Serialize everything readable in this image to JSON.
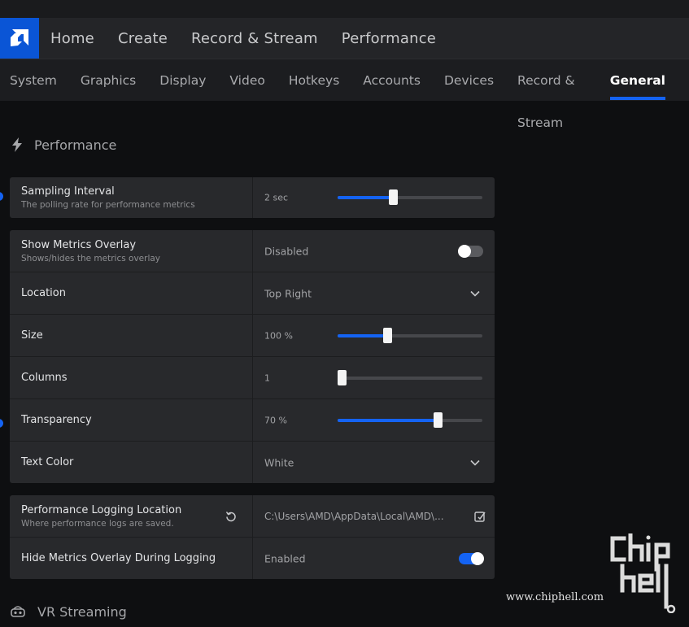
{
  "main_nav": [
    "Home",
    "Create",
    "Record & Stream",
    "Performance"
  ],
  "sub_tabs": [
    "System",
    "Graphics",
    "Display",
    "Video",
    "Hotkeys",
    "Accounts",
    "Devices",
    "Record & Stream",
    "General"
  ],
  "active_tab": "General",
  "section_title": "Performance",
  "section_icon": "lightning-icon",
  "next_section_title": "VR Streaming",
  "next_section_icon": "vr-headset-icon",
  "sampling": {
    "label": "Sampling Interval",
    "desc": "The polling rate for performance metrics",
    "value": "2 sec",
    "level": 0.38
  },
  "overlay": {
    "label": "Show Metrics Overlay",
    "desc": "Shows/hides the metrics overlay",
    "value": "Disabled",
    "enabled": false
  },
  "location": {
    "label": "Location",
    "value": "Top Right"
  },
  "size": {
    "label": "Size",
    "value": "100 %",
    "level": 0.34
  },
  "columns": {
    "label": "Columns",
    "value": "1",
    "level": 0.03
  },
  "transparency": {
    "label": "Transparency",
    "value": "70 %",
    "level": 0.69
  },
  "text_color": {
    "label": "Text Color",
    "value": "White"
  },
  "logging_location": {
    "label": "Performance Logging Location",
    "desc": "Where performance logs are saved.",
    "value": "C:\\Users\\AMD\\AppData\\Local\\AMD\\..."
  },
  "hide_overlay": {
    "label": "Hide Metrics Overlay During Logging",
    "value": "Enabled",
    "enabled": true
  },
  "watermark": {
    "url": "www.chiphell.com"
  },
  "colors": {
    "accent": "#1463f3",
    "logo_bg": "#0a55d6",
    "card_bg": "#28292c",
    "page_bg": "#0e0f11"
  }
}
